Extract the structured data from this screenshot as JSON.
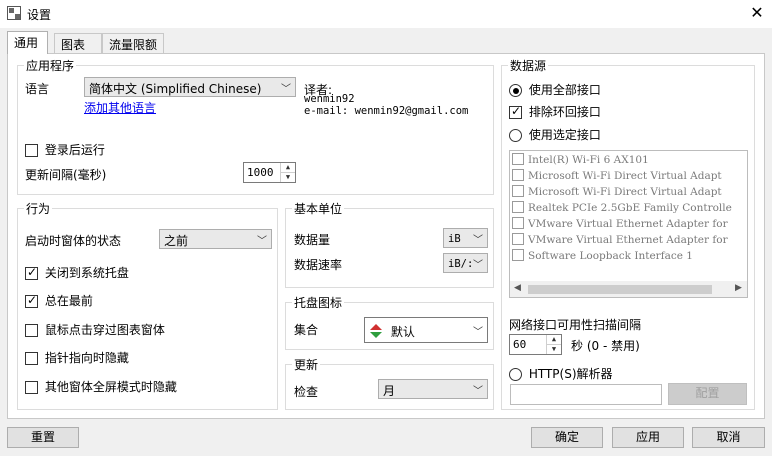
{
  "window": {
    "title": "设置"
  },
  "tabs": [
    {
      "label": "通用"
    },
    {
      "label": "图表"
    },
    {
      "label": "流量限额"
    }
  ],
  "app": {
    "title": "应用程序",
    "language_label": "语言",
    "language_value": "简体中文 (Simplified Chinese)",
    "add_language_link": "添加其他语言",
    "translator_label": "译者:",
    "translator_name": "wenmin92",
    "translator_email": "e-mail: wenmin92@gmail.com",
    "run_on_login_label": "登录后运行",
    "run_on_login_checked": false,
    "update_interval_label": "更新间隔(毫秒)",
    "update_interval_value": "1000"
  },
  "behavior": {
    "title": "行为",
    "startup_state_label": "启动时窗体的状态",
    "startup_state_value": "之前",
    "options": [
      {
        "label": "关闭到系统托盘",
        "checked": true
      },
      {
        "label": "总在最前",
        "checked": true
      },
      {
        "label": "鼠标点击穿过图表窗体",
        "checked": false
      },
      {
        "label": "指针指向时隐藏",
        "checked": false
      },
      {
        "label": "其他窗体全屏模式时隐藏",
        "checked": false
      }
    ]
  },
  "units": {
    "title": "基本单位",
    "data_label": "数据量",
    "data_value": "iB",
    "rate_label": "数据速率",
    "rate_value": "iB/:"
  },
  "tray": {
    "title": "托盘图标",
    "set_label": "集合",
    "set_value": "默认"
  },
  "update": {
    "title": "更新",
    "check_label": "检查",
    "check_value": "月"
  },
  "datasource": {
    "title": "数据源",
    "use_all_label": "使用全部接口",
    "use_all_selected": true,
    "exclude_loopback_label": "排除环回接口",
    "exclude_loopback_checked": true,
    "use_selected_label": "使用选定接口",
    "use_selected_selected": false,
    "interfaces": [
      "Intel(R) Wi-Fi 6 AX101",
      "Microsoft Wi-Fi Direct Virtual Adapt",
      "Microsoft Wi-Fi Direct Virtual Adapt",
      "Realtek PCIe 2.5GbE Family Controlle",
      "VMware Virtual Ethernet Adapter for",
      "VMware Virtual Ethernet Adapter for",
      "Software Loopback Interface 1"
    ],
    "scan_interval_label": "网络接口可用性扫描间隔",
    "scan_interval_value": "60",
    "scan_interval_hint": "秒 (0 - 禁用)",
    "http_parser_label": "HTTP(S)解析器",
    "http_parser_selected": false,
    "http_input_value": "",
    "config_button": "配置"
  },
  "footer": {
    "reset": "重置",
    "ok": "确定",
    "apply": "应用",
    "cancel": "取消"
  },
  "icons": {
    "close": "close-icon",
    "tray_set": "up-down-arrows-icon"
  },
  "colors": {
    "link": "#0000ee",
    "tray_up": "#d03030",
    "tray_down": "#2e9e3e"
  }
}
